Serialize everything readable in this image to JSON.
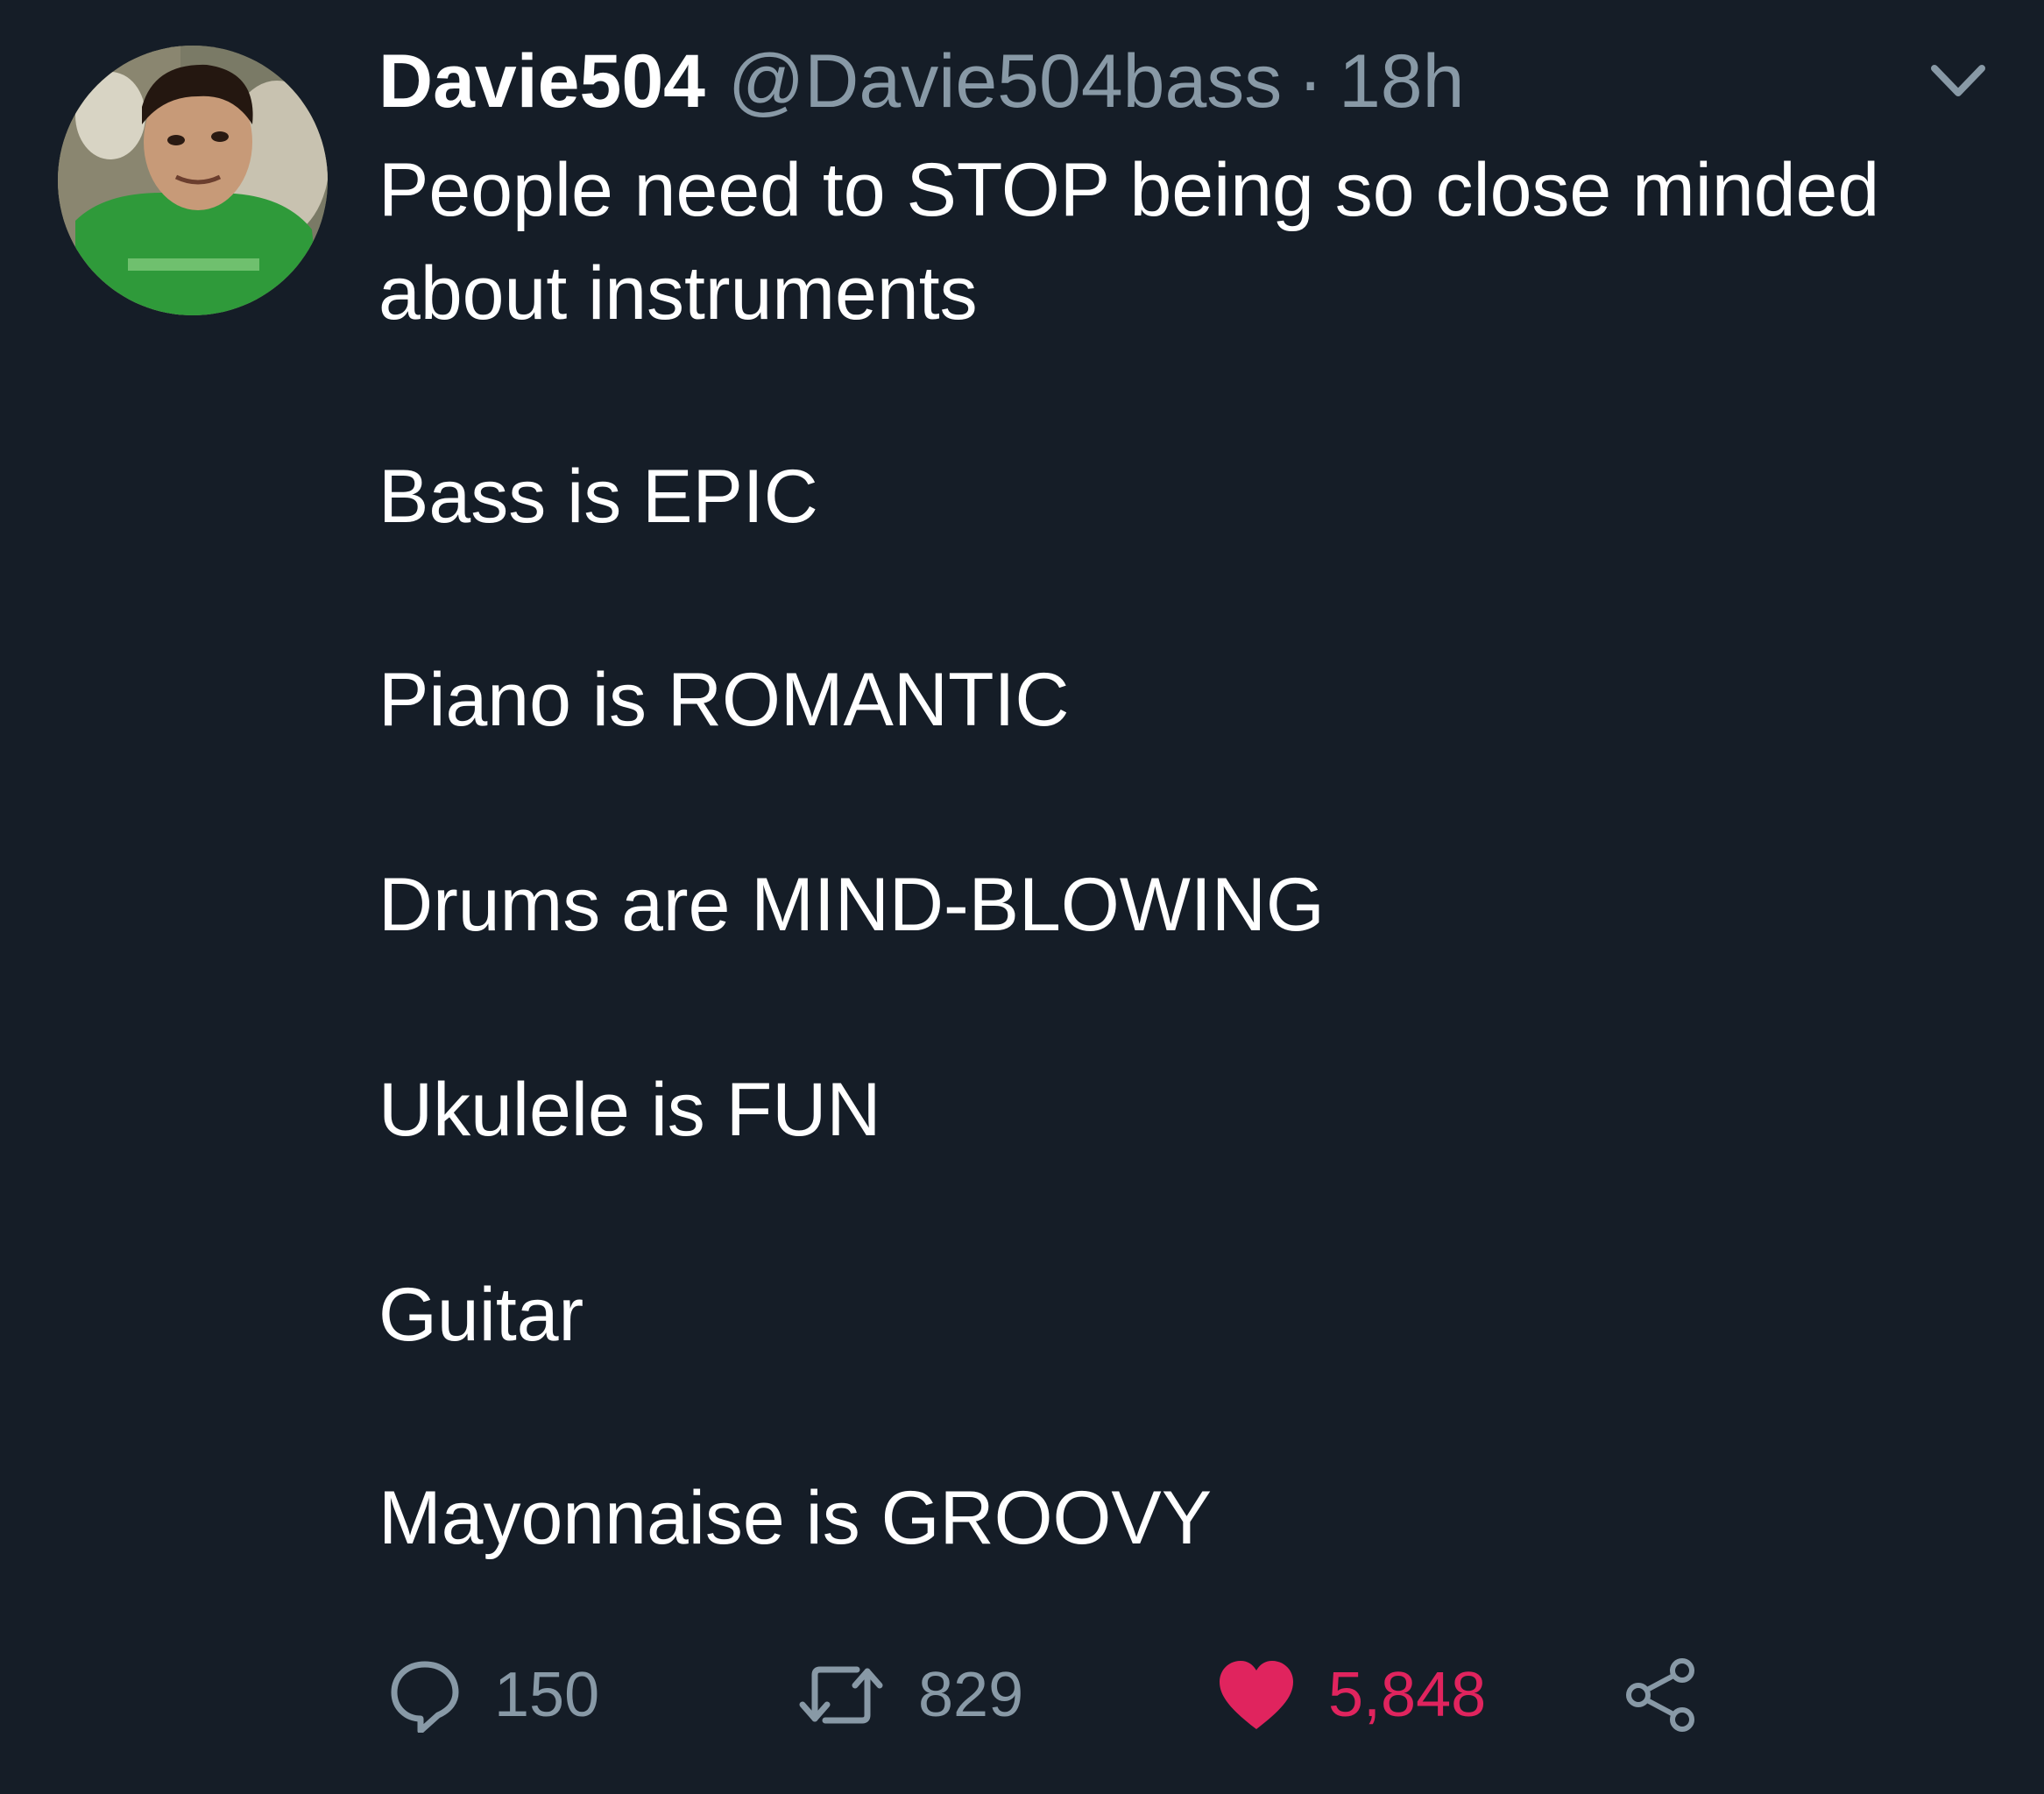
{
  "tweet": {
    "display_name": "Davie504",
    "handle": "@Davie504bass",
    "separator": "·",
    "timestamp": "18h",
    "text_lines": [
      "People need to STOP being so close minded",
      "about instruments",
      "Bass is EPIC",
      "Piano is ROMANTIC",
      "Drums are MIND-BLOWING",
      "Ukulele is FUN",
      "Guitar",
      "Mayonnaise is GROOVY"
    ]
  },
  "actions": {
    "reply_count": "150",
    "retweet_count": "829",
    "like_count": "5,848"
  },
  "icons": {
    "reply": "reply-icon",
    "retweet": "retweet-icon",
    "like": "heart-icon",
    "share": "share-icon",
    "caret": "chevron-down-icon"
  },
  "colors": {
    "background": "#151d27",
    "text": "#ffffff",
    "muted": "#8899a6",
    "like": "#e0245e"
  }
}
